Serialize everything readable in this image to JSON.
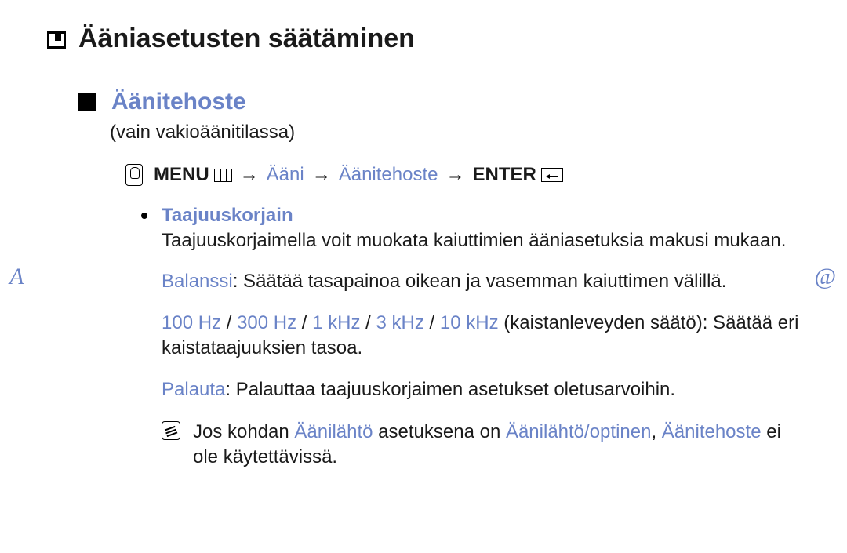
{
  "title": "Ääniasetusten säätäminen",
  "section": {
    "heading": "Äänitehoste",
    "subtitle": "(vain vakioäänitilassa)"
  },
  "menu_path": {
    "menu_label": "MENU",
    "step1": "Ääni",
    "step2": "Äänitehoste",
    "enter_label": "ENTER",
    "arrow": "→"
  },
  "equalizer": {
    "title": "Taajuuskorjain",
    "desc": "Taajuuskorjaimella voit muokata kaiuttimien ääniasetuksia makusi mukaan.",
    "balance_label": "Balanssi",
    "balance_rest": ": Säätää tasapainoa oikean ja vasemman kaiuttimen välillä.",
    "freqs": [
      "100 Hz",
      "300 Hz",
      "1 kHz",
      "3 kHz",
      "10 kHz"
    ],
    "freq_sep": " / ",
    "freq_rest": " (kaistanleveyden säätö): Säätää eri kaistataajuuksien tasoa.",
    "reset_label": "Palauta",
    "reset_rest": ": Palauttaa taajuuskorjaimen asetukset oletusarvoihin."
  },
  "note": {
    "pre": "Jos kohdan ",
    "term1": "Äänilähtö",
    "mid1": " asetuksena on ",
    "term2": "Äänilähtö/optinen",
    "sep": ", ",
    "term3": "Äänitehoste",
    "post": " ei ole käytettävissä."
  },
  "nav": {
    "prev": "A",
    "next": "@"
  }
}
